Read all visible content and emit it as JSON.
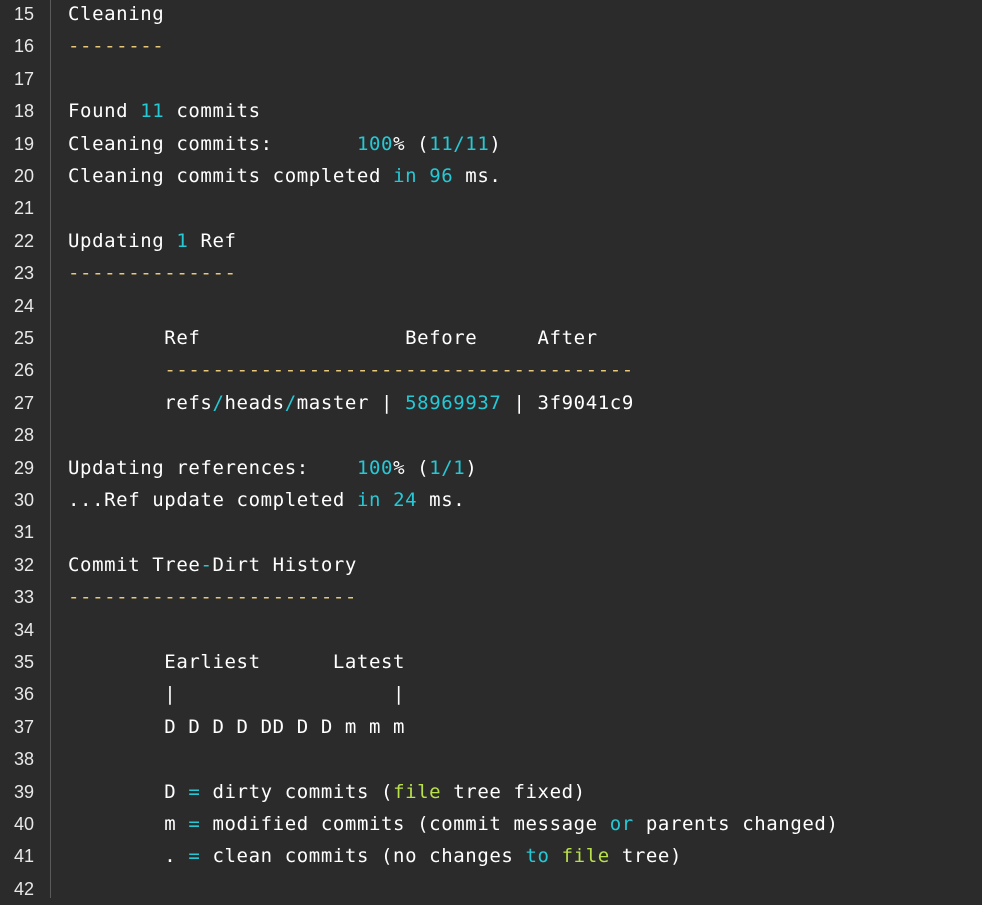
{
  "colors": {
    "background": "#2b2b2b",
    "text": "#ffffff",
    "keyword": "#25c9d6",
    "separator": "#e8c87a",
    "filename": "#b8e04a",
    "gutter_rule": "#5a5a5a"
  },
  "lines": [
    {
      "n": "15",
      "segs": [
        {
          "t": "Cleaning",
          "c": "white"
        }
      ]
    },
    {
      "n": "16",
      "segs": [
        {
          "t": "--------",
          "c": "yellow"
        }
      ]
    },
    {
      "n": "17",
      "segs": []
    },
    {
      "n": "18",
      "segs": [
        {
          "t": "Found ",
          "c": "white"
        },
        {
          "t": "11",
          "c": "cyan"
        },
        {
          "t": " commits",
          "c": "white"
        }
      ]
    },
    {
      "n": "19",
      "segs": [
        {
          "t": "Cleaning commits:       ",
          "c": "white"
        },
        {
          "t": "100",
          "c": "cyan"
        },
        {
          "t": "% (",
          "c": "white"
        },
        {
          "t": "11/11",
          "c": "cyan"
        },
        {
          "t": ")",
          "c": "white"
        }
      ]
    },
    {
      "n": "20",
      "segs": [
        {
          "t": "Cleaning commits completed ",
          "c": "white"
        },
        {
          "t": "in",
          "c": "cyan"
        },
        {
          "t": " ",
          "c": "white"
        },
        {
          "t": "96",
          "c": "cyan"
        },
        {
          "t": " ms.",
          "c": "white"
        }
      ]
    },
    {
      "n": "21",
      "segs": []
    },
    {
      "n": "22",
      "segs": [
        {
          "t": "Updating ",
          "c": "white"
        },
        {
          "t": "1",
          "c": "cyan"
        },
        {
          "t": " Ref",
          "c": "white"
        }
      ]
    },
    {
      "n": "23",
      "segs": [
        {
          "t": "--------------",
          "c": "yellow"
        }
      ]
    },
    {
      "n": "24",
      "segs": []
    },
    {
      "n": "25",
      "segs": [
        {
          "t": "        Ref                 Before     After",
          "c": "white"
        }
      ]
    },
    {
      "n": "26",
      "segs": [
        {
          "t": "        ",
          "c": "white"
        },
        {
          "t": "---------------------------------------",
          "c": "yellow"
        }
      ]
    },
    {
      "n": "27",
      "segs": [
        {
          "t": "        refs",
          "c": "white"
        },
        {
          "t": "/",
          "c": "cyan"
        },
        {
          "t": "heads",
          "c": "white"
        },
        {
          "t": "/",
          "c": "cyan"
        },
        {
          "t": "master | ",
          "c": "white"
        },
        {
          "t": "58969937",
          "c": "cyan"
        },
        {
          "t": " | 3f9041c9",
          "c": "white"
        }
      ]
    },
    {
      "n": "28",
      "segs": []
    },
    {
      "n": "29",
      "segs": [
        {
          "t": "Updating references:    ",
          "c": "white"
        },
        {
          "t": "100",
          "c": "cyan"
        },
        {
          "t": "% (",
          "c": "white"
        },
        {
          "t": "1/1",
          "c": "cyan"
        },
        {
          "t": ")",
          "c": "white"
        }
      ]
    },
    {
      "n": "30",
      "segs": [
        {
          "t": "...Ref update completed ",
          "c": "white"
        },
        {
          "t": "in",
          "c": "cyan"
        },
        {
          "t": " ",
          "c": "white"
        },
        {
          "t": "24",
          "c": "cyan"
        },
        {
          "t": " ms.",
          "c": "white"
        }
      ]
    },
    {
      "n": "31",
      "segs": []
    },
    {
      "n": "32",
      "segs": [
        {
          "t": "Commit Tree",
          "c": "white"
        },
        {
          "t": "-",
          "c": "cyan"
        },
        {
          "t": "Dirt History",
          "c": "white"
        }
      ]
    },
    {
      "n": "33",
      "segs": [
        {
          "t": "------------------------",
          "c": "yellow"
        }
      ]
    },
    {
      "n": "34",
      "segs": []
    },
    {
      "n": "35",
      "segs": [
        {
          "t": "        Earliest      Latest",
          "c": "white"
        }
      ]
    },
    {
      "n": "36",
      "segs": [
        {
          "t": "        |                  |",
          "c": "white"
        }
      ]
    },
    {
      "n": "37",
      "segs": [
        {
          "t": "        D D D D DD D D m m m",
          "c": "white"
        }
      ]
    },
    {
      "n": "38",
      "segs": []
    },
    {
      "n": "39",
      "segs": [
        {
          "t": "        D ",
          "c": "white"
        },
        {
          "t": "=",
          "c": "cyan"
        },
        {
          "t": " dirty commits (",
          "c": "white"
        },
        {
          "t": "file",
          "c": "lime"
        },
        {
          "t": " tree fixed)",
          "c": "white"
        }
      ]
    },
    {
      "n": "40",
      "segs": [
        {
          "t": "        m ",
          "c": "white"
        },
        {
          "t": "=",
          "c": "cyan"
        },
        {
          "t": " modified commits (commit message ",
          "c": "white"
        },
        {
          "t": "or",
          "c": "cyan"
        },
        {
          "t": " parents changed)",
          "c": "white"
        }
      ]
    },
    {
      "n": "41",
      "segs": [
        {
          "t": "        . ",
          "c": "white"
        },
        {
          "t": "=",
          "c": "cyan"
        },
        {
          "t": " clean commits (no changes ",
          "c": "white"
        },
        {
          "t": "to",
          "c": "cyan"
        },
        {
          "t": " ",
          "c": "white"
        },
        {
          "t": "file",
          "c": "lime"
        },
        {
          "t": " tree)",
          "c": "white"
        }
      ]
    },
    {
      "n": "42",
      "segs": []
    }
  ]
}
